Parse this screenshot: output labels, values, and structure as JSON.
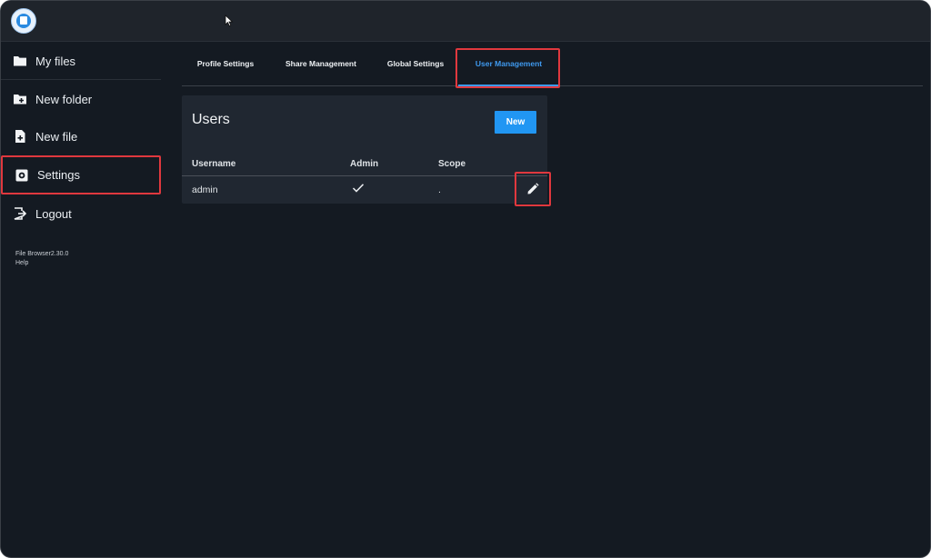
{
  "sidebar": {
    "items": [
      {
        "label": "My files",
        "icon": "folder-icon"
      },
      {
        "label": "New folder",
        "icon": "folder-plus-icon"
      },
      {
        "label": "New file",
        "icon": "file-plus-icon"
      },
      {
        "label": "Settings",
        "icon": "settings-icon"
      },
      {
        "label": "Logout",
        "icon": "logout-icon"
      }
    ],
    "footer": {
      "version": "File Browser2.30.0",
      "help": "Help"
    }
  },
  "tabs": [
    {
      "label": "Profile Settings"
    },
    {
      "label": "Share Management"
    },
    {
      "label": "Global Settings"
    },
    {
      "label": "User Management",
      "active": true
    }
  ],
  "users": {
    "title": "Users",
    "new_label": "New",
    "columns": [
      "Username",
      "Admin",
      "Scope"
    ],
    "rows": [
      {
        "username": "admin",
        "admin": true,
        "scope": "."
      }
    ]
  },
  "colors": {
    "accent": "#2196f3",
    "highlight": "#e0383e",
    "background": "#141a22"
  }
}
